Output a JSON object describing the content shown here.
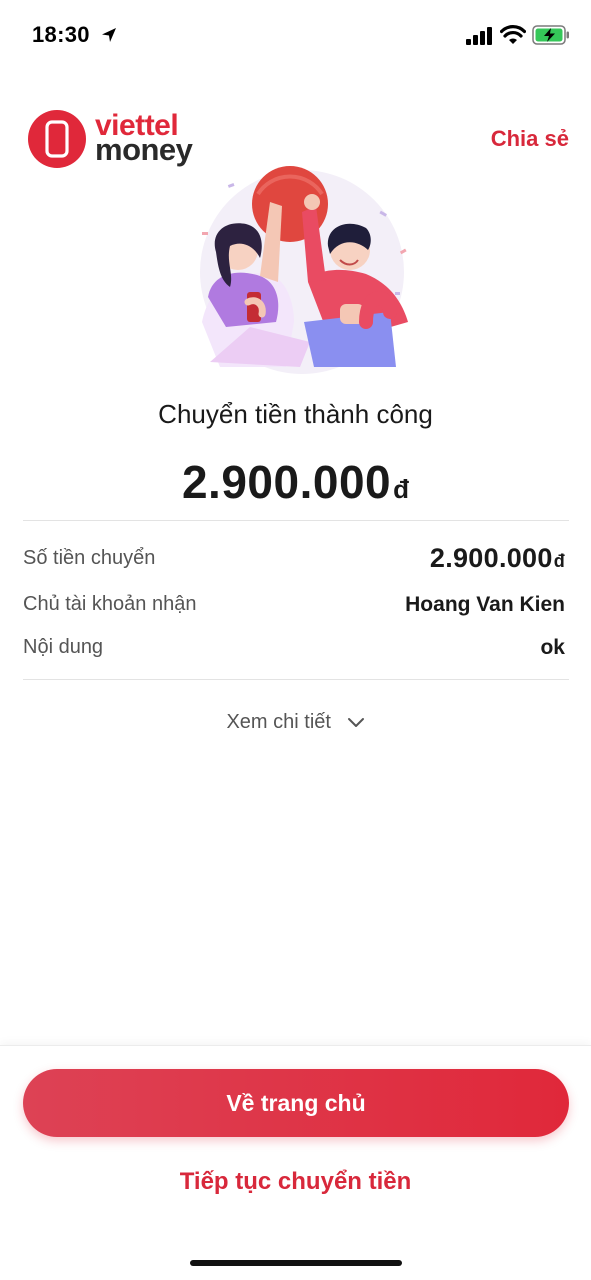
{
  "status_bar": {
    "time": "18:30",
    "icons": [
      "location-arrow-icon",
      "cellular-signal-icon",
      "wifi-icon",
      "battery-charging-icon"
    ]
  },
  "header": {
    "logo_line1": "viettel",
    "logo_line2": "money",
    "share_label": "Chia sẻ"
  },
  "result": {
    "title": "Chuyển tiền thành công",
    "amount": "2.900.000",
    "currency": "đ"
  },
  "details": [
    {
      "label": "Số tiền chuyển",
      "value": "2.900.000",
      "currency": "đ"
    },
    {
      "label": "Chủ tài khoản nhận",
      "value": "Hoang Van Kien"
    },
    {
      "label": "Nội dung",
      "value": "ok"
    }
  ],
  "toggle": {
    "label": "Xem chi tiết",
    "icon": "chevron-down-icon"
  },
  "actions": {
    "primary_label": "Về trang chủ",
    "secondary_label": "Tiếp tục chuyển tiền"
  },
  "colors": {
    "brand_red": "#e0283a",
    "link_red": "#d8283b",
    "text_dark": "#1a1a1a",
    "text_muted": "#555555"
  }
}
